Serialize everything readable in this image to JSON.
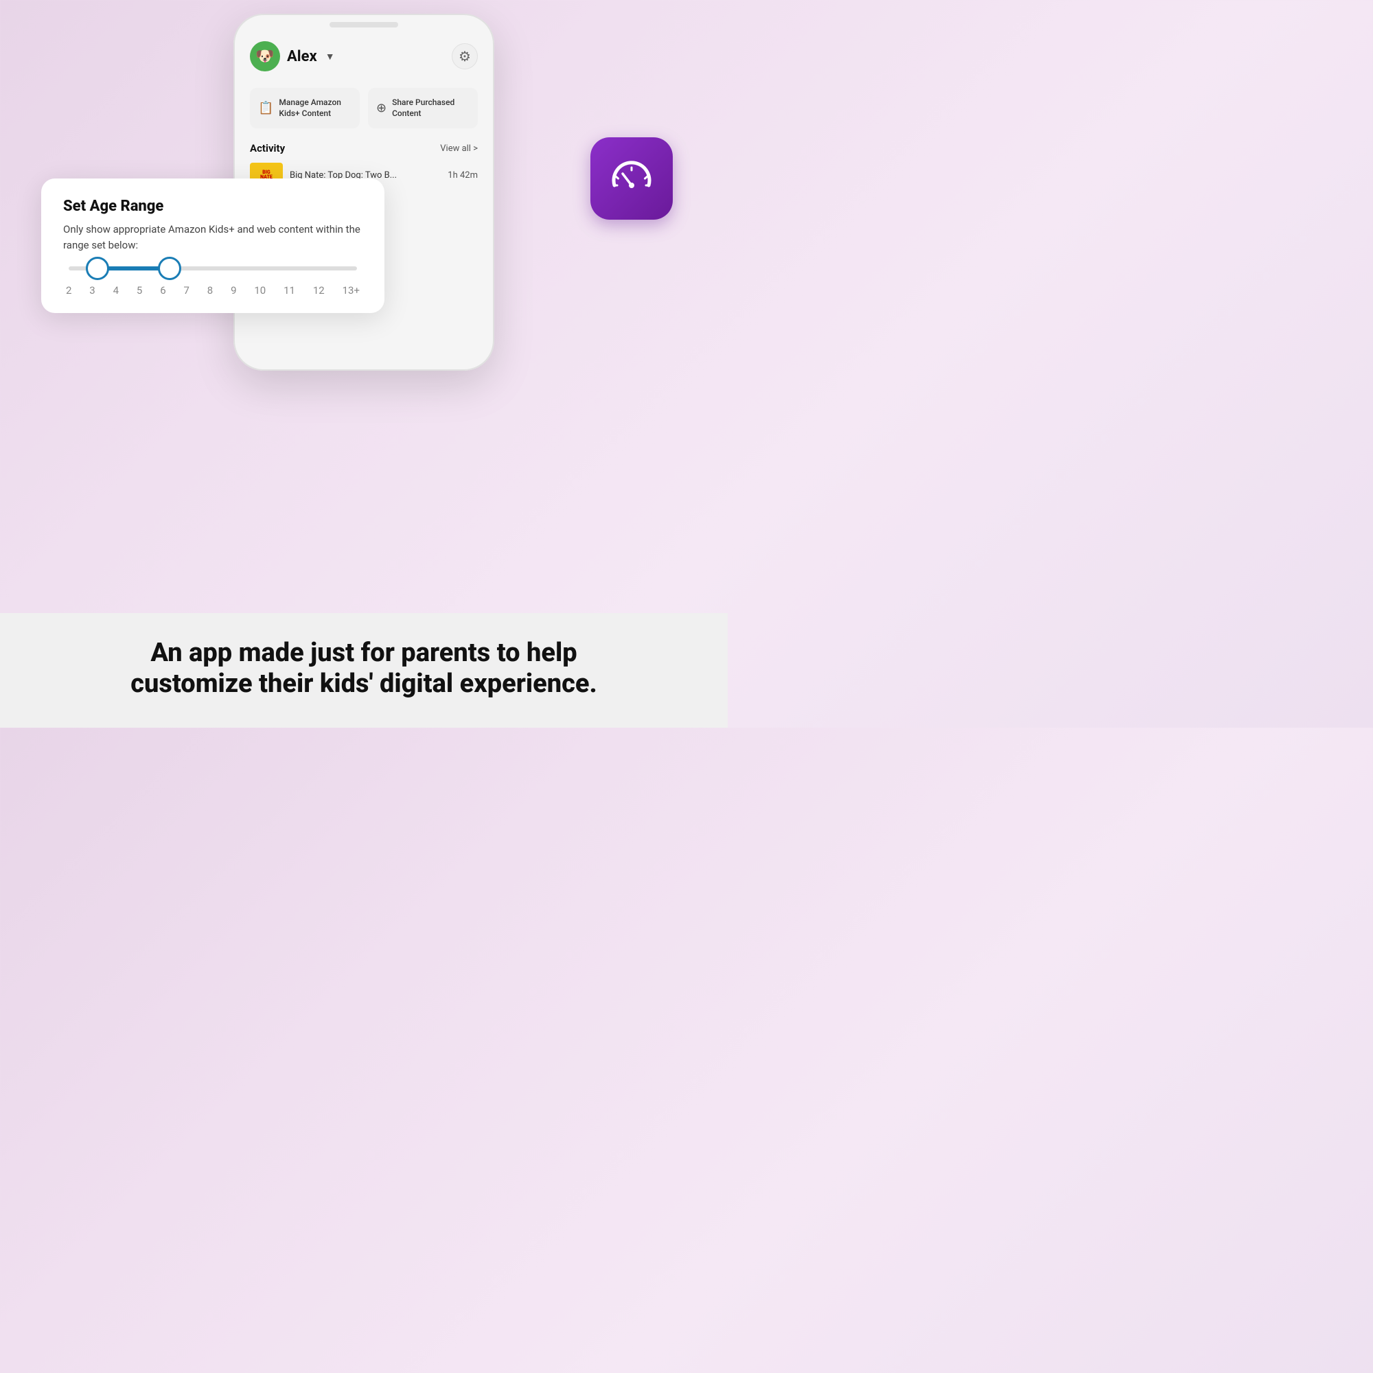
{
  "background": {
    "gradient_start": "#e8d5e8",
    "gradient_end": "#f5e8f5"
  },
  "phone": {
    "profile": {
      "name": "Alex",
      "dropdown_arrow": "▼",
      "avatar_emoji": "🐶"
    },
    "settings_icon": "⚙",
    "action_buttons": [
      {
        "icon": "📋",
        "label": "Manage Amazon Kids+ Content"
      },
      {
        "icon": "⊕",
        "label": "Share Purchased Content"
      }
    ],
    "activity": {
      "title": "Activity",
      "view_all": "View all >",
      "items": [
        {
          "thumb_label": "BIG NATE AND FRIENDS",
          "title": "Big Nate: Top Dog: Two B...",
          "duration": "1h 42m"
        }
      ]
    }
  },
  "age_range_card": {
    "title": "Set Age Range",
    "description": "Only show appropriate Amazon Kids+ and web content within the range set below:",
    "slider": {
      "min_value": 2,
      "max_value_label": "13+",
      "selected_min": 2,
      "selected_max": 5,
      "labels": [
        "2",
        "3",
        "4",
        "5",
        "6",
        "7",
        "8",
        "9",
        "10",
        "11",
        "12",
        "13+"
      ]
    }
  },
  "app_icon": {
    "alt": "Amazon Kids+ Parent Dashboard App Icon",
    "bg_color": "#7b1fa2"
  },
  "tagline": {
    "line1": "An app made just for parents to help",
    "line2": "customize their kids' digital experience."
  }
}
